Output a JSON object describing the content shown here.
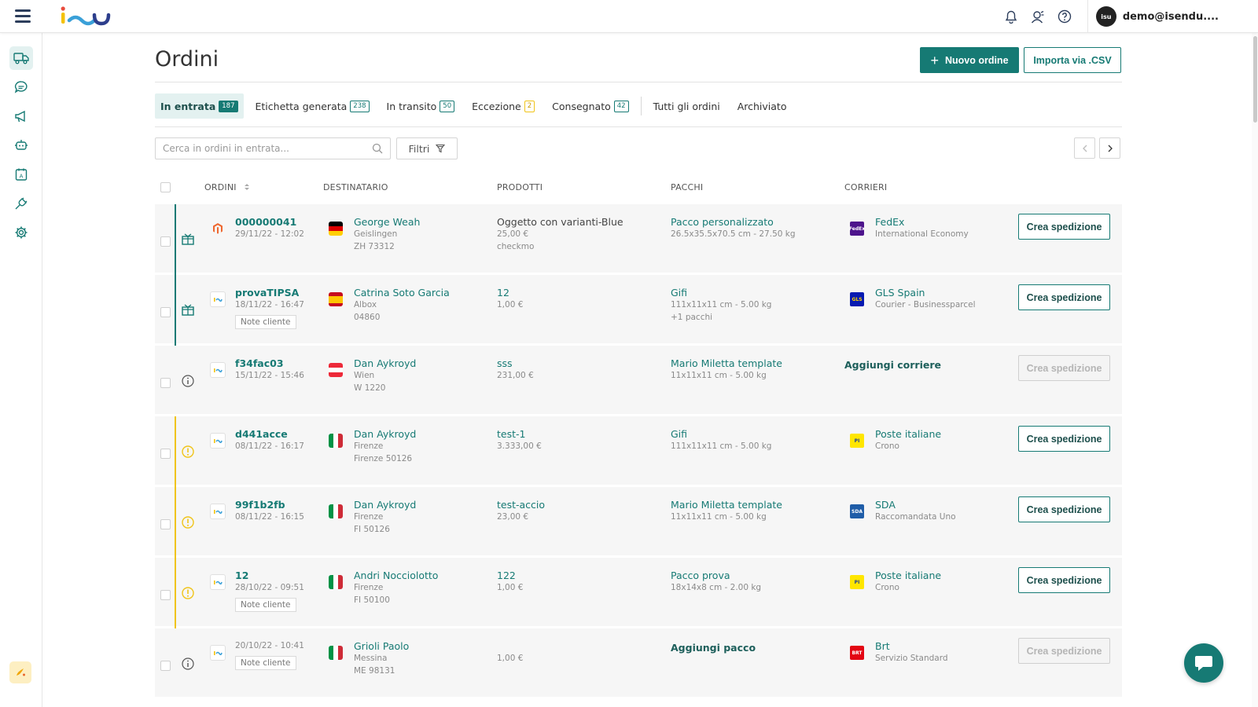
{
  "header": {
    "user_email": "demo@isendu....",
    "avatar_text": "isu"
  },
  "page": {
    "title": "Ordini",
    "new_order_label": "Nuovo ordine",
    "import_label": "Importa via .CSV"
  },
  "tabs": [
    {
      "label": "In entrata",
      "count": "187"
    },
    {
      "label": "Etichetta generata",
      "count": "238"
    },
    {
      "label": "In transito",
      "count": "50"
    },
    {
      "label": "Eccezione",
      "count": "2"
    },
    {
      "label": "Consegnato",
      "count": "42"
    },
    {
      "label": "Tutti gli ordini"
    },
    {
      "label": "Archiviato"
    }
  ],
  "search": {
    "placeholder": "Cerca in ordini in entrata..."
  },
  "filter_label": "Filtri",
  "columns": {
    "orders": "ORDINI",
    "recipient": "DESTINATARIO",
    "products": "PRODOTTI",
    "packages": "PACCHI",
    "carriers": "CORRIERI"
  },
  "rows": [
    {
      "order": "000000041",
      "date": "29/11/22 - 12:02",
      "note": "",
      "name": "George Weah",
      "city": "Geislingen",
      "zip": "ZH 73312",
      "product": "Oggetto con varianti-Blue",
      "price": "25,00 €",
      "extra": "checkmo",
      "package": "Pacco personalizzato",
      "package_dims": "26.5x35.5x70.5 cm - 27.50 kg",
      "package_extra": "",
      "carrier": "FedEx",
      "service": "International Economy",
      "ship_label": "Crea spedizione",
      "enabled": true
    },
    {
      "order": "provaTIPSA",
      "date": "18/11/22 - 16:47",
      "note": "Note cliente",
      "name": "Catrina Soto Garcia",
      "city": "Albox",
      "zip": "04860",
      "product": "12",
      "price": "1,00 €",
      "extra": "",
      "package": "Gifi",
      "package_dims": "111x11x11 cm - 5.00 kg",
      "package_extra": "+1 pacchi",
      "carrier": "GLS Spain",
      "service": "Courier - Businessparcel",
      "ship_label": "Crea spedizione",
      "enabled": true
    },
    {
      "order": "f34fac03",
      "date": "15/11/22 - 15:46",
      "note": "",
      "name": "Dan Aykroyd",
      "city": "Wien",
      "zip": "W 1220",
      "product": "sss",
      "price": "231,00 €",
      "extra": "",
      "package": "Mario Miletta template",
      "package_dims": "11x11x11 cm - 5.00 kg",
      "package_extra": "",
      "carrier_action": "Aggiungi corriere",
      "ship_label": "Crea spedizione",
      "enabled": false
    },
    {
      "order": "d441acce",
      "date": "08/11/22 - 16:17",
      "note": "",
      "name": "Dan Aykroyd",
      "city": "Firenze",
      "zip": "Firenze 50126",
      "product": "test-1",
      "price": "3.333,00 €",
      "extra": "",
      "package": "Gifi",
      "package_dims": "111x11x11 cm - 5.00 kg",
      "package_extra": "",
      "carrier": "Poste italiane",
      "service": "Crono",
      "ship_label": "Crea spedizione",
      "enabled": true
    },
    {
      "order": "99f1b2fb",
      "date": "08/11/22 - 16:15",
      "note": "",
      "name": "Dan Aykroyd",
      "city": "Firenze",
      "zip": "FI 50126",
      "product": "test-accio",
      "price": "23,00 €",
      "extra": "",
      "package": "Mario Miletta template",
      "package_dims": "11x11x11 cm - 5.00 kg",
      "package_extra": "",
      "carrier": "SDA",
      "service": "Raccomandata Uno",
      "ship_label": "Crea spedizione",
      "enabled": true
    },
    {
      "order": "12",
      "date": "28/10/22 - 09:51",
      "note": "Note cliente",
      "name": "Andri Nocciolotto",
      "city": "Firenze",
      "zip": "FI 50100",
      "product": "122",
      "price": "1,00 €",
      "extra": "",
      "package": "Pacco prova",
      "package_dims": "18x14x8 cm - 2.00 kg",
      "package_extra": "",
      "carrier": "Poste italiane",
      "service": "Crono",
      "ship_label": "Crea spedizione",
      "enabled": true
    },
    {
      "order": "",
      "date": "20/10/22 - 10:41",
      "note": "Note cliente",
      "name": "Grioli Paolo",
      "city": "Messina",
      "zip": "ME 98131",
      "product": "",
      "price": "1,00 €",
      "extra": "",
      "package_action": "Aggiungi pacco",
      "carrier": "Brt",
      "service": "Servizio Standard",
      "ship_label": "Crea spedizione",
      "enabled": false
    }
  ],
  "colors": {
    "accent": "#167a74",
    "warning": "#f0c419",
    "text": "#333333",
    "row_bg": "#f6f6f6"
  }
}
